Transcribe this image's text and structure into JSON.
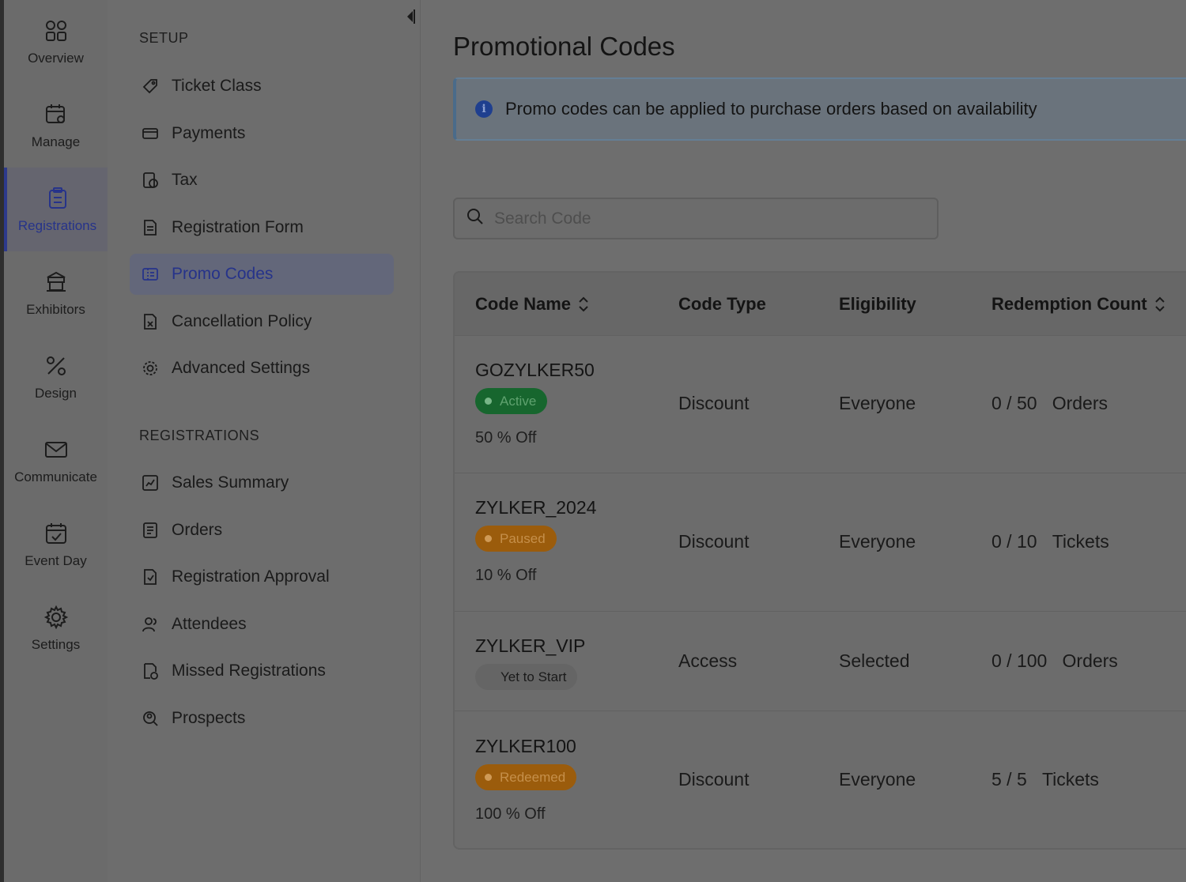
{
  "rail": {
    "items": [
      {
        "label": "Overview",
        "icon": "grid-icon"
      },
      {
        "label": "Manage",
        "icon": "calendar-gear-icon"
      },
      {
        "label": "Registrations",
        "icon": "clipboard-icon",
        "active": true
      },
      {
        "label": "Exhibitors",
        "icon": "booth-icon"
      },
      {
        "label": "Design",
        "icon": "percent-brush-icon"
      },
      {
        "label": "Communicate",
        "icon": "mail-icon"
      },
      {
        "label": "Event Day",
        "icon": "calendar-check-icon"
      },
      {
        "label": "Settings",
        "icon": "gear-icon"
      }
    ]
  },
  "nav": {
    "setup_heading": "SETUP",
    "setup_items": [
      {
        "label": "Ticket Class",
        "icon": "ticket-icon"
      },
      {
        "label": "Payments",
        "icon": "card-icon"
      },
      {
        "label": "Tax",
        "icon": "tax-icon"
      },
      {
        "label": "Registration Form",
        "icon": "form-icon"
      },
      {
        "label": "Promo Codes",
        "icon": "promo-icon",
        "active": true
      },
      {
        "label": "Cancellation Policy",
        "icon": "cancel-doc-icon"
      },
      {
        "label": "Advanced Settings",
        "icon": "gear-icon"
      }
    ],
    "registrations_heading": "REGISTRATIONS",
    "registrations_items": [
      {
        "label": "Sales Summary",
        "icon": "chart-icon"
      },
      {
        "label": "Orders",
        "icon": "orders-icon"
      },
      {
        "label": "Registration Approval",
        "icon": "approval-icon"
      },
      {
        "label": "Attendees",
        "icon": "people-icon"
      },
      {
        "label": "Missed Registrations",
        "icon": "missed-icon"
      },
      {
        "label": "Prospects",
        "icon": "prospect-icon"
      }
    ]
  },
  "main": {
    "title": "Promotional Codes",
    "banner": "Promo codes can be applied to purchase orders based on availability",
    "search_placeholder": "Search Code",
    "columns": [
      "Code Name",
      "Code Type",
      "Eligibility",
      "Redemption Count"
    ],
    "rows": [
      {
        "code": "GOZYLKER50",
        "status": "Active",
        "status_kind": "active",
        "offer": "50 % Off",
        "type": "Discount",
        "eligibility": "Everyone",
        "redeemed": "0 / 50",
        "unit": "Orders"
      },
      {
        "code": "ZYLKER_2024",
        "status": "Paused",
        "status_kind": "paused",
        "offer": "10 % Off",
        "type": "Discount",
        "eligibility": "Everyone",
        "redeemed": "0 / 10",
        "unit": "Tickets"
      },
      {
        "code": "ZYLKER_VIP",
        "status": "Yet to Start",
        "status_kind": "yet",
        "offer": "",
        "type": "Access",
        "eligibility": "Selected",
        "redeemed": "0 / 100",
        "unit": "Orders"
      },
      {
        "code": "ZYLKER100",
        "status": "Redeemed",
        "status_kind": "redeemed",
        "offer": "100 % Off",
        "type": "Discount",
        "eligibility": "Everyone",
        "redeemed": "5 / 5",
        "unit": "Tickets"
      }
    ]
  }
}
